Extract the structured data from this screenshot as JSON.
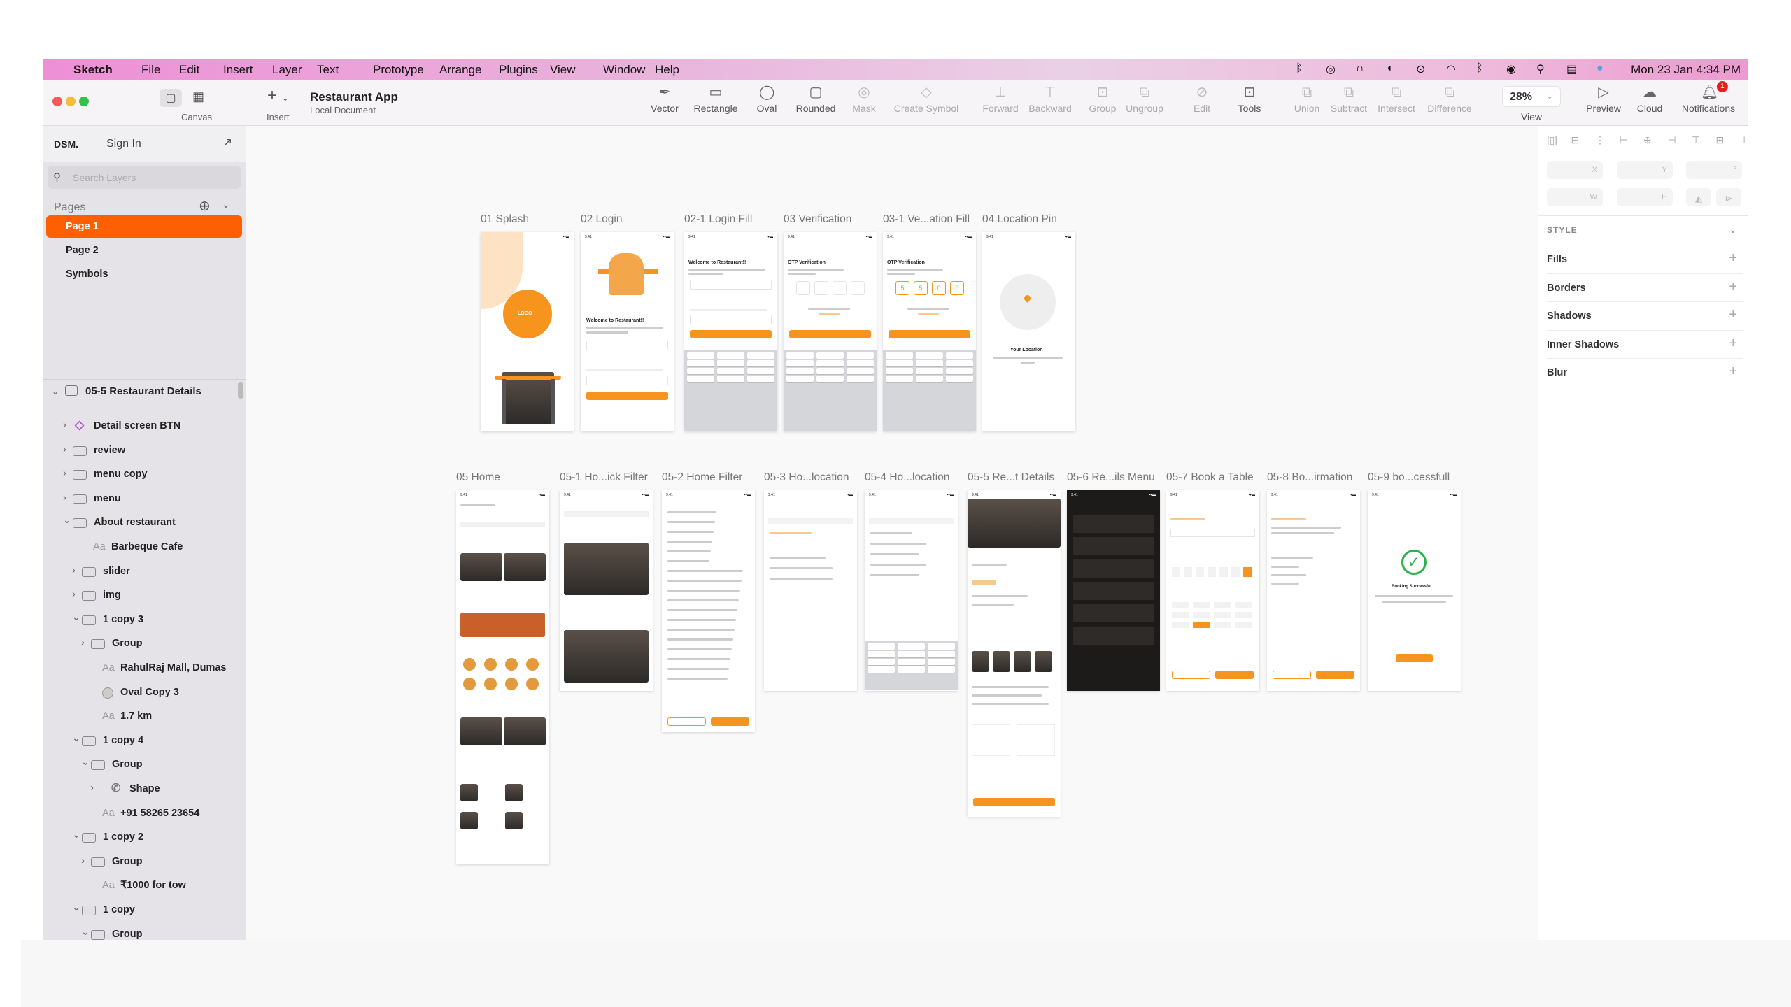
{
  "menubar": {
    "app": "Sketch",
    "items": [
      "File",
      "Edit",
      "Insert",
      "Layer",
      "Text",
      "Prototype",
      "Arrange",
      "Plugins",
      "View",
      "Window",
      "Help"
    ],
    "clock": "Mon 23 Jan  4:34 PM"
  },
  "toolbar": {
    "canvas_label": "Canvas",
    "insert_label": "Insert",
    "doc_title": "Restaurant App",
    "doc_subtitle": "Local Document",
    "tools": [
      {
        "label": "Vector",
        "icon": "pen-icon",
        "enabled": true
      },
      {
        "label": "Rectangle",
        "icon": "rectangle-icon",
        "enabled": true
      },
      {
        "label": "Oval",
        "icon": "oval-icon",
        "enabled": true
      },
      {
        "label": "Rounded",
        "icon": "rounded-rect-icon",
        "enabled": true
      },
      {
        "label": "Mask",
        "icon": "mask-icon",
        "enabled": false
      },
      {
        "label": "Create Symbol",
        "icon": "symbol-icon",
        "enabled": false
      },
      {
        "label": "Forward",
        "icon": "forward-icon",
        "enabled": false
      },
      {
        "label": "Backward",
        "icon": "backward-icon",
        "enabled": false
      },
      {
        "label": "Group",
        "icon": "group-icon",
        "enabled": false
      },
      {
        "label": "Ungroup",
        "icon": "ungroup-icon",
        "enabled": false
      },
      {
        "label": "Edit",
        "icon": "edit-icon",
        "enabled": false
      },
      {
        "label": "Tools",
        "icon": "tools-icon",
        "enabled": true
      },
      {
        "label": "Union",
        "icon": "union-icon",
        "enabled": false
      },
      {
        "label": "Subtract",
        "icon": "subtract-icon",
        "enabled": false
      },
      {
        "label": "Intersect",
        "icon": "intersect-icon",
        "enabled": false
      },
      {
        "label": "Difference",
        "icon": "difference-icon",
        "enabled": false
      }
    ],
    "zoom": "28%",
    "view_label": "View",
    "preview_label": "Preview",
    "cloud_label": "Cloud",
    "notifications_label": "Notifications",
    "notification_count": "1"
  },
  "sidebar": {
    "dsm": "DSM.",
    "sign_in": "Sign In",
    "search_placeholder": "Search Layers",
    "pages_label": "Pages",
    "pages": [
      "Page 1",
      "Page 2",
      "Symbols"
    ],
    "selected_page": 0,
    "artboard": "05-5 Restaurant Details",
    "layers": [
      {
        "name": "Detail screen BTN",
        "type": "symbol",
        "depth": 0,
        "chevron": "right"
      },
      {
        "name": "review",
        "type": "folder",
        "depth": 0,
        "chevron": "right"
      },
      {
        "name": "menu copy",
        "type": "folder",
        "depth": 0,
        "chevron": "right"
      },
      {
        "name": "menu",
        "type": "folder",
        "depth": 0,
        "chevron": "right"
      },
      {
        "name": "About restaurant",
        "type": "folder",
        "depth": 0,
        "chevron": "down"
      },
      {
        "name": "Barbeque Cafe",
        "type": "text",
        "depth": 1,
        "chevron": ""
      },
      {
        "name": "slider",
        "type": "folder",
        "depth": 1,
        "chevron": "right"
      },
      {
        "name": "img",
        "type": "folder",
        "depth": 1,
        "chevron": "right"
      },
      {
        "name": "1 copy 3",
        "type": "folder",
        "depth": 1,
        "chevron": "down"
      },
      {
        "name": "Group",
        "type": "folder",
        "depth": 2,
        "chevron": "right"
      },
      {
        "name": "RahulRaj Mall, Dumas",
        "type": "text",
        "depth": 2,
        "chevron": ""
      },
      {
        "name": "Oval Copy 3",
        "type": "oval",
        "depth": 2,
        "chevron": ""
      },
      {
        "name": "1.7 km",
        "type": "text",
        "depth": 2,
        "chevron": ""
      },
      {
        "name": "1 copy 4",
        "type": "folder",
        "depth": 1,
        "chevron": "down"
      },
      {
        "name": "Group",
        "type": "folder",
        "depth": 2,
        "chevron": "down"
      },
      {
        "name": "Shape",
        "type": "phone",
        "depth": 3,
        "chevron": "right"
      },
      {
        "name": "+91 58265 23654",
        "type": "text",
        "depth": 2,
        "chevron": ""
      },
      {
        "name": "1 copy 2",
        "type": "folder",
        "depth": 1,
        "chevron": "down"
      },
      {
        "name": "Group",
        "type": "folder",
        "depth": 2,
        "chevron": "right"
      },
      {
        "name": "₹1000 for tow",
        "type": "text",
        "depth": 2,
        "chevron": ""
      },
      {
        "name": "1 copy",
        "type": "folder",
        "depth": 1,
        "chevron": "down"
      },
      {
        "name": "Group",
        "type": "folder",
        "depth": 2,
        "chevron": "down"
      }
    ]
  },
  "inspector": {
    "x": "X",
    "y": "Y",
    "rotation": "°",
    "w": "W",
    "h": "H",
    "style_label": "STYLE",
    "sections": [
      "Fills",
      "Borders",
      "Shadows",
      "Inner Shadows",
      "Blur"
    ]
  },
  "artboards": {
    "row1": [
      "01 Splash",
      "02 Login",
      "02-1 Login Fill",
      "03 Verification",
      "03-1 Ve...ation Fill",
      "04 Location Pin"
    ],
    "row2": [
      "05 Home",
      "05-1 Ho...ick Filter",
      "05-2 Home Filter",
      "05-3 Ho...location",
      "05-4 Ho...location",
      "05-5 Re...t Details",
      "05-6 Re...ils Menu",
      "05-7 Book a Table",
      "05-8 Bo...irmation",
      "05-9 bo...cessfull"
    ],
    "texts": {
      "logo": "LOGO",
      "welcome": "Welcome to Restaurant!!",
      "otp": "OTP Verification",
      "location": "Your Location",
      "success": "Booking Successful",
      "otp_digits": [
        "5",
        "5",
        "0",
        "0"
      ]
    }
  },
  "colors": {
    "accent": "#FF5F00",
    "brand_orange": "#F7941D",
    "notification_badge": "#E0201B"
  }
}
